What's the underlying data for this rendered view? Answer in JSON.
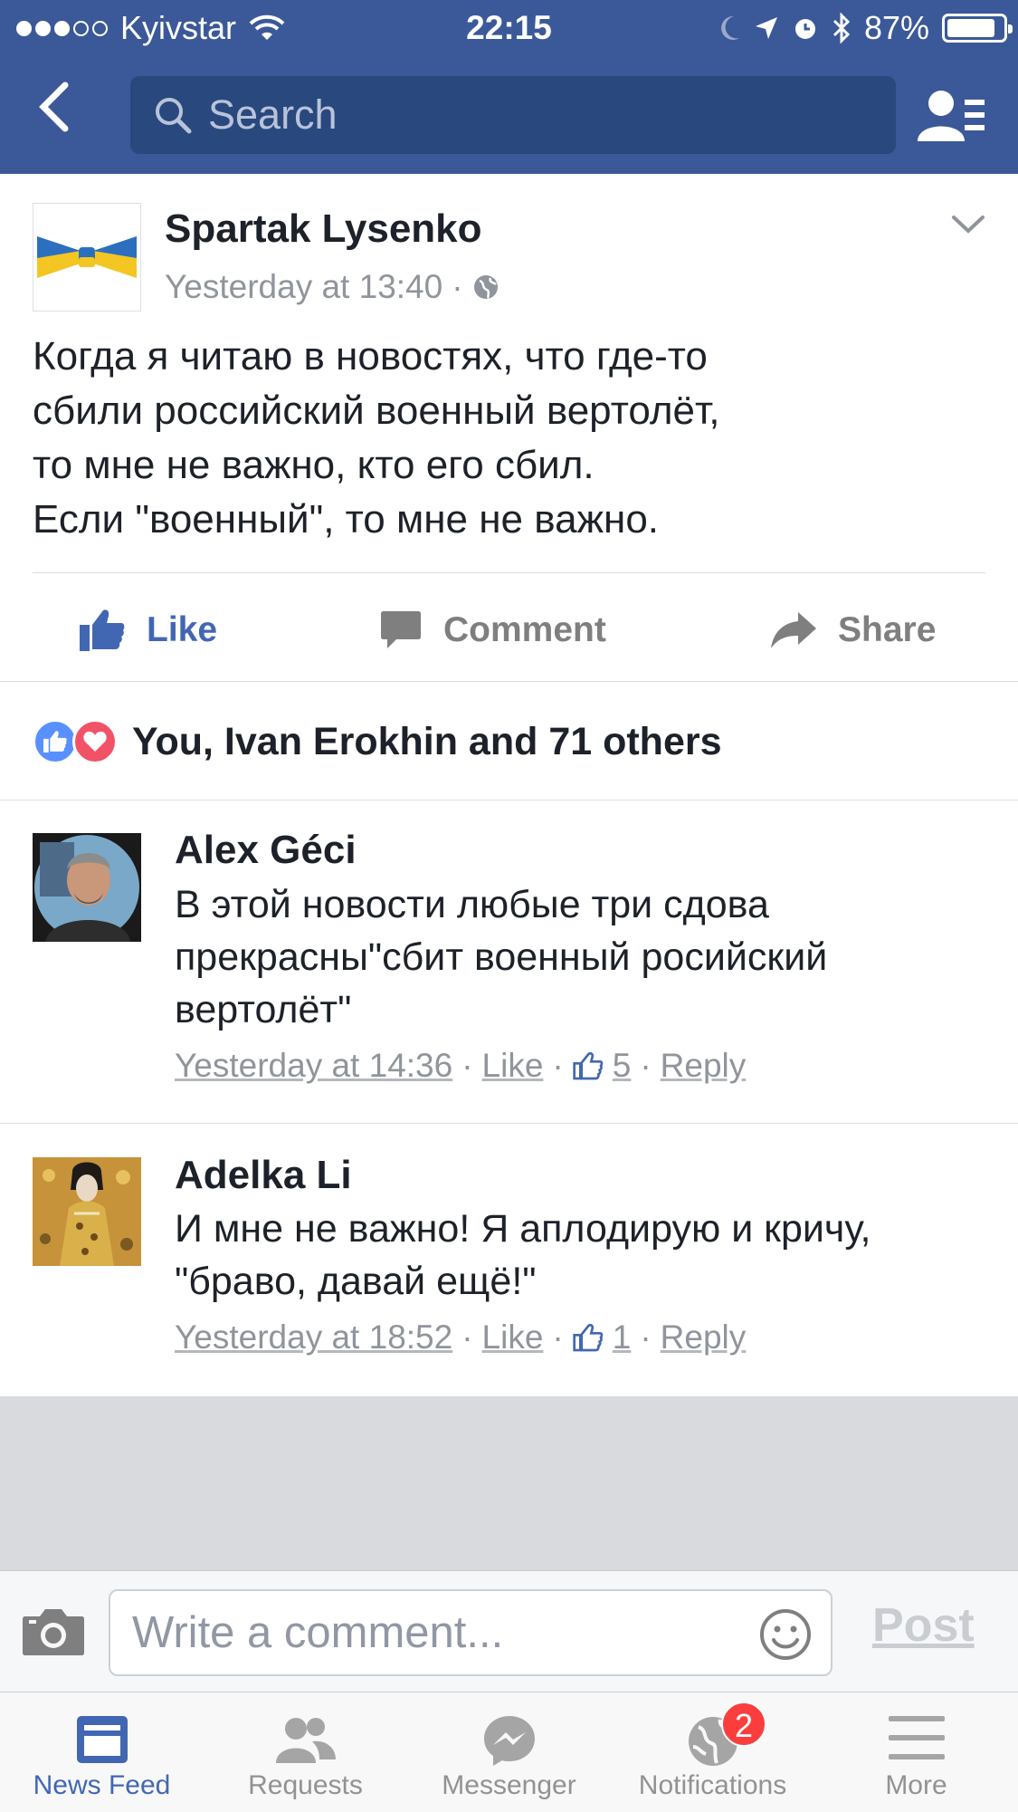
{
  "status_bar": {
    "carrier": "Kyivstar",
    "time": "22:15",
    "battery": "87%",
    "battery_level": 0.87
  },
  "nav": {
    "search_placeholder": "Search"
  },
  "post": {
    "author": "Spartak Lysenko",
    "timestamp": "Yesterday at 13:40",
    "separator": "·",
    "text_lines": [
      "Когда я читаю в новостях, что где-то",
      "сбили российский военный вертолёт,",
      "то мне не важно, кто его сбил.",
      "Если \"военный\", то мне не важно."
    ],
    "actions": {
      "like": "Like",
      "comment": "Comment",
      "share": "Share"
    },
    "reactions_summary": "You, Ivan Erokhin and 71 others"
  },
  "comments": [
    {
      "author": "Alex Géci",
      "text_lines": [
        "В этой новости любые три сдова",
        "прекрасны\"сбит военный росийский",
        "вертолёт\""
      ],
      "timestamp": "Yesterday at 14:36",
      "like_label": "Like",
      "like_count": "5",
      "reply_label": "Reply"
    },
    {
      "author": "Adelka Li",
      "text_lines": [
        "И мне не важно! Я аплодирую и кричу,",
        "\"браво, давай ещё!\""
      ],
      "timestamp": "Yesterday at 18:52",
      "like_label": "Like",
      "like_count": "1",
      "reply_label": "Reply"
    }
  ],
  "composer": {
    "placeholder": "Write a comment...",
    "post_label": "Post"
  },
  "tabbar": {
    "tabs": [
      {
        "label": "News Feed",
        "icon": "news-feed-icon",
        "active": true
      },
      {
        "label": "Requests",
        "icon": "friend-requests-icon",
        "active": false
      },
      {
        "label": "Messenger",
        "icon": "messenger-icon",
        "active": false
      },
      {
        "label": "Notifications",
        "icon": "globe-icon",
        "active": false,
        "badge": "2"
      },
      {
        "label": "More",
        "icon": "menu-icon",
        "active": false
      }
    ]
  },
  "colors": {
    "brand": "#3b5998",
    "link_blue": "#4267b2",
    "badge_red": "#fa3e3e",
    "love_red": "#f25268",
    "like_blue": "#5890ff"
  }
}
